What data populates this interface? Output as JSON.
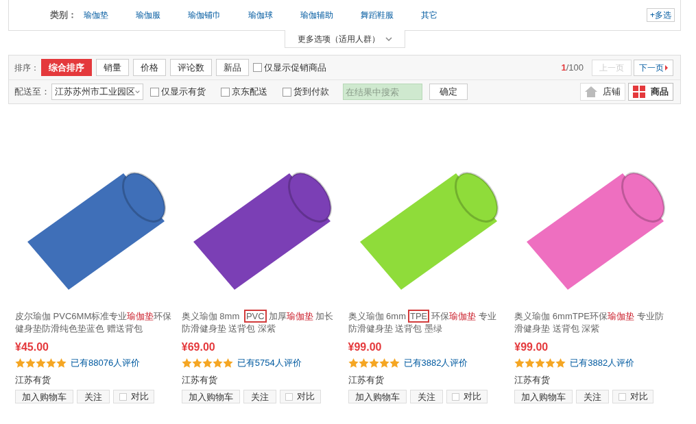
{
  "category_filter": {
    "label": "类别：",
    "options": [
      "瑜伽垫",
      "瑜伽服",
      "瑜伽铺巾",
      "瑜伽球",
      "瑜伽辅助",
      "舞蹈鞋服",
      "其它"
    ],
    "multi_button": "+多选"
  },
  "more_options": "更多选项（适用人群）",
  "sort_bar": {
    "label": "排序：",
    "tabs": [
      {
        "label": "综合排序",
        "selected": true
      },
      {
        "label": "销量",
        "selected": false
      },
      {
        "label": "价格",
        "selected": false
      },
      {
        "label": "评论数",
        "selected": false
      },
      {
        "label": "新品",
        "selected": false
      }
    ],
    "promo_only": {
      "label": "仅显示促销商品",
      "checked": false
    },
    "page_current": "1",
    "page_total": "/100",
    "prev": "上一页",
    "next": "下一页"
  },
  "filter_bar": {
    "ship_label": "配送至：",
    "location": "江苏苏州市工业园区",
    "checks": [
      {
        "label": "仅显示有货",
        "checked": false
      },
      {
        "label": "京东配送",
        "checked": false
      },
      {
        "label": "货到付款",
        "checked": false
      }
    ],
    "search_placeholder": "在结果中搜索",
    "confirm": "确定",
    "views": [
      {
        "label": "店铺",
        "kind": "shop",
        "selected": false
      },
      {
        "label": "商品",
        "kind": "grid",
        "selected": true
      }
    ]
  },
  "products": [
    {
      "title": [
        {
          "kind": "plain",
          "text": "皮尔瑜伽 PVC6MM标准专业"
        },
        {
          "kind": "keyword",
          "text": "瑜伽垫"
        },
        {
          "kind": "plain",
          "text": "环保健身垫防滑纯色垫蓝色 赠送背包"
        }
      ],
      "price": "¥45.00",
      "stars": 5,
      "reviews": "已有88076人评价",
      "stock": "江苏有货",
      "cart": "加入购物车",
      "follow": "关注",
      "compare": {
        "label": "对比",
        "checked": false
      }
    },
    {
      "title": [
        {
          "kind": "plain",
          "text": "奥义瑜伽 8mm "
        },
        {
          "kind": "boxed",
          "text": "PVC"
        },
        {
          "kind": "plain",
          "text": "加厚"
        },
        {
          "kind": "keyword",
          "text": "瑜伽垫"
        },
        {
          "kind": "plain",
          "text": " 加长防滑健身垫 送背包 深紫"
        }
      ],
      "price": "¥69.00",
      "stars": 5,
      "reviews": "已有5754人评价",
      "stock": "江苏有货",
      "cart": "加入购物车",
      "follow": "关注",
      "compare": {
        "label": "对比",
        "checked": false
      }
    },
    {
      "title": [
        {
          "kind": "plain",
          "text": "奥义瑜伽 6mm"
        },
        {
          "kind": "boxed",
          "text": "TPE"
        },
        {
          "kind": "plain",
          "text": "环保"
        },
        {
          "kind": "keyword",
          "text": "瑜伽垫"
        },
        {
          "kind": "plain",
          "text": " 专业防滑健身垫 送背包 墨绿"
        }
      ],
      "price": "¥99.00",
      "stars": 5,
      "reviews": "已有3882人评价",
      "stock": "江苏有货",
      "cart": "加入购物车",
      "follow": "关注",
      "compare": {
        "label": "对比",
        "checked": false
      }
    },
    {
      "title": [
        {
          "kind": "plain",
          "text": "奥义瑜伽 6mmTPE环保"
        },
        {
          "kind": "keyword",
          "text": "瑜伽垫"
        },
        {
          "kind": "plain",
          "text": " 专业防滑健身垫 送背包 深紫"
        }
      ],
      "price": "¥99.00",
      "stars": 5,
      "reviews": "已有3882人评价",
      "stock": "江苏有货",
      "cart": "加入购物车",
      "follow": "关注",
      "compare": {
        "label": "对比",
        "checked": false
      }
    }
  ]
}
